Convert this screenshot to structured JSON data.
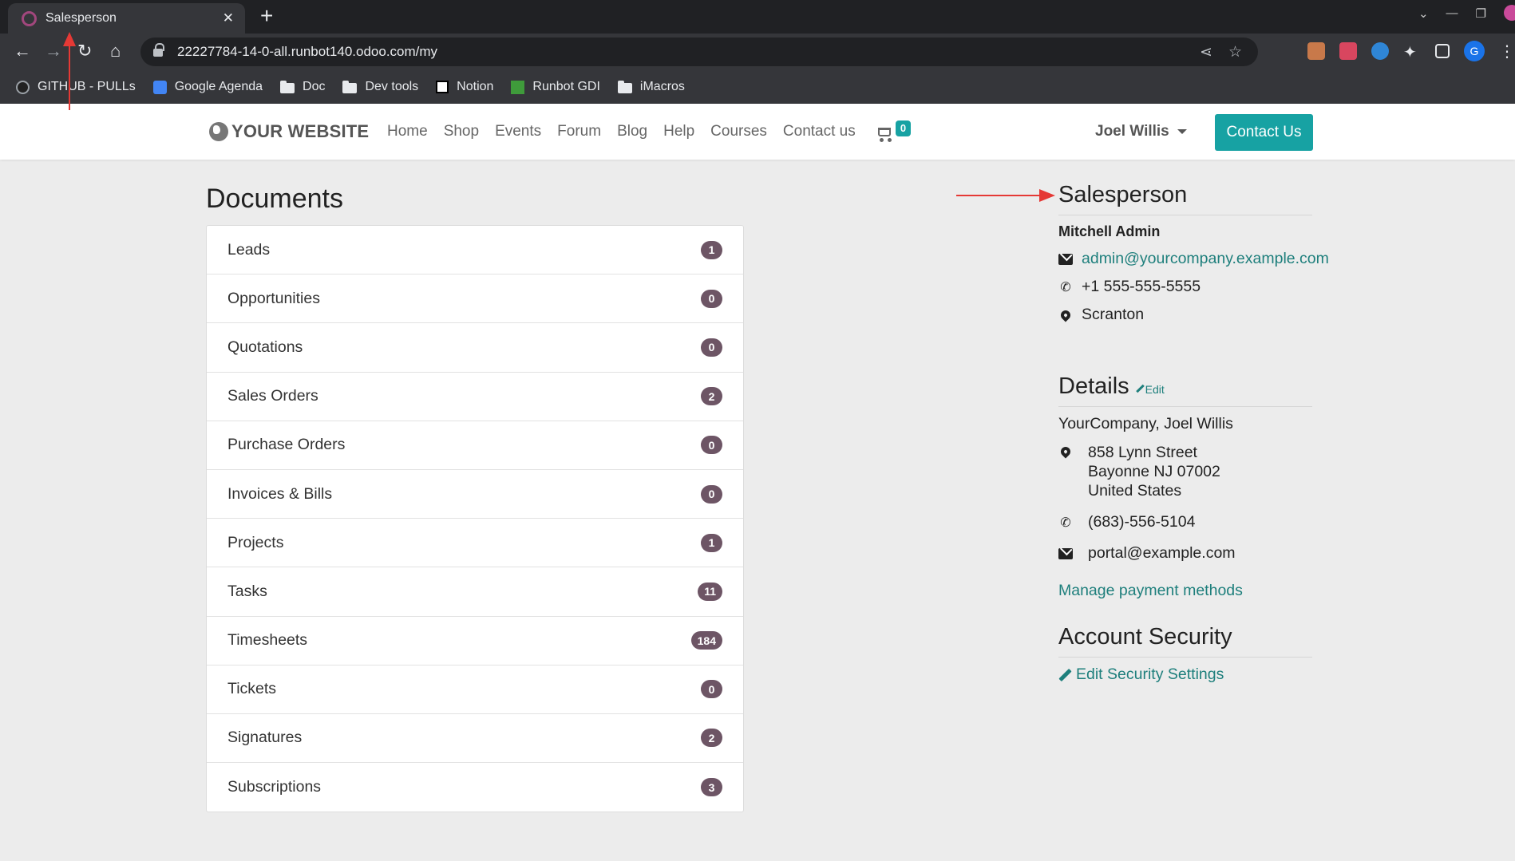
{
  "browser": {
    "tab_title": "Salesperson",
    "tab_close": "✕",
    "new_tab": "+",
    "url": "22227784-14-0-all.runbot140.odoo.com/my",
    "profile_initial": "G",
    "bookmarks": [
      {
        "label": "GITHUB - PULLs",
        "icon": "github-icon"
      },
      {
        "label": "Google Agenda",
        "icon": "calendar-icon"
      },
      {
        "label": "Doc",
        "icon": "folder-icon"
      },
      {
        "label": "Dev tools",
        "icon": "folder-icon"
      },
      {
        "label": "Notion",
        "icon": "notion-icon"
      },
      {
        "label": "Runbot GDI",
        "icon": "runbot-icon"
      },
      {
        "label": "iMacros",
        "icon": "folder-icon"
      }
    ]
  },
  "header": {
    "logo_text": "YOUR WEBSITE",
    "menu": [
      "Home",
      "Shop",
      "Events",
      "Forum",
      "Blog",
      "Help",
      "Courses",
      "Contact us"
    ],
    "cart_count": "0",
    "user_name": "Joel Willis",
    "contact_button": "Contact Us"
  },
  "documents": {
    "title": "Documents",
    "items": [
      {
        "label": "Leads",
        "count": "1"
      },
      {
        "label": "Opportunities",
        "count": "0"
      },
      {
        "label": "Quotations",
        "count": "0"
      },
      {
        "label": "Sales Orders",
        "count": "2"
      },
      {
        "label": "Purchase Orders",
        "count": "0"
      },
      {
        "label": "Invoices & Bills",
        "count": "0"
      },
      {
        "label": "Projects",
        "count": "1"
      },
      {
        "label": "Tasks",
        "count": "11"
      },
      {
        "label": "Timesheets",
        "count": "184"
      },
      {
        "label": "Tickets",
        "count": "0"
      },
      {
        "label": "Signatures",
        "count": "2"
      },
      {
        "label": "Subscriptions",
        "count": "3"
      }
    ]
  },
  "salesperson": {
    "title": "Salesperson",
    "name": "Mitchell Admin",
    "email": "admin@yourcompany.example.com",
    "phone": "+1 555-555-5555",
    "city": "Scranton"
  },
  "details": {
    "title": "Details",
    "edit_label": "Edit",
    "company": "YourCompany, Joel Willis",
    "address_line1": "858 Lynn Street",
    "address_line2": "Bayonne NJ 07002",
    "address_line3": "United States",
    "phone": "(683)-556-5104",
    "email": "portal@example.com",
    "manage_payment": "Manage payment methods"
  },
  "security": {
    "title": "Account Security",
    "edit_link": "Edit Security Settings"
  },
  "colors": {
    "accent": "#17a2a3",
    "link": "#1e7f7c",
    "badge": "#6d5565",
    "annotation_arrow": "#e53935"
  }
}
